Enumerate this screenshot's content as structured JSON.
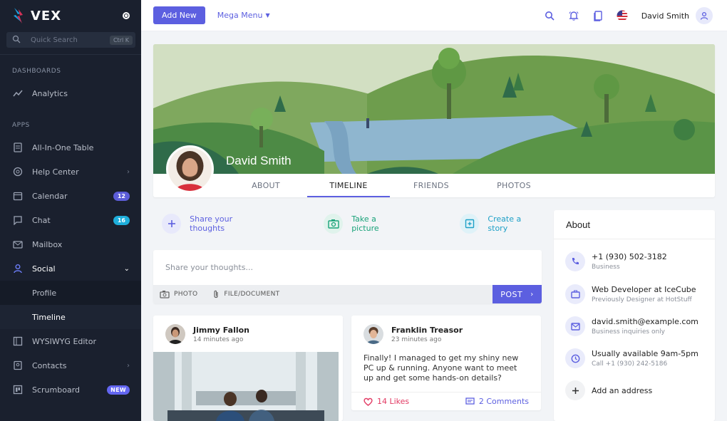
{
  "brand": {
    "name": "VEX"
  },
  "search": {
    "placeholder": "Quick Search",
    "shortcut": "Ctrl K"
  },
  "sidebar": {
    "sections": [
      {
        "label": "DASHBOARDS"
      },
      {
        "label": "APPS"
      }
    ],
    "items": [
      {
        "label": "Analytics",
        "icon": "chart-line-icon"
      },
      {
        "label": "All-In-One Table",
        "icon": "table-icon"
      },
      {
        "label": "Help Center",
        "icon": "help-icon"
      },
      {
        "label": "Calendar",
        "icon": "calendar-icon",
        "badge": "12"
      },
      {
        "label": "Chat",
        "icon": "chat-icon",
        "badge": "16"
      },
      {
        "label": "Mailbox",
        "icon": "mail-icon"
      },
      {
        "label": "Social",
        "icon": "user-icon"
      },
      {
        "label": "WYSIWYG Editor",
        "icon": "editor-icon"
      },
      {
        "label": "Contacts",
        "icon": "contacts-icon"
      },
      {
        "label": "Scrumboard",
        "icon": "board-icon",
        "badge": "NEW"
      }
    ],
    "social_children": [
      {
        "label": "Profile"
      },
      {
        "label": "Timeline"
      }
    ]
  },
  "topbar": {
    "add_new": "Add New",
    "mega_menu": "Mega Menu",
    "user_name": "David Smith"
  },
  "profile": {
    "name": "David Smith",
    "tabs": [
      {
        "label": "ABOUT"
      },
      {
        "label": "TIMELINE"
      },
      {
        "label": "FRIENDS"
      },
      {
        "label": "PHOTOS"
      }
    ]
  },
  "share": {
    "thoughts": "Share your thoughts",
    "picture": "Take a picture",
    "story": "Create a story"
  },
  "composer": {
    "placeholder": "Share your thoughts...",
    "photo": "PHOTO",
    "file": "FILE/DOCUMENT",
    "post": "POST"
  },
  "posts": [
    {
      "author": "Jimmy Fallon",
      "time": "14 minutes ago"
    },
    {
      "author": "Franklin Treasor",
      "time": "23 minutes ago",
      "text": "Finally! I managed to get my shiny new PC up & running. Anyone want to meet up and get some hands-on details?",
      "likes": "14 Likes",
      "comments": "2 Comments"
    }
  ],
  "about": {
    "title": "About",
    "items": [
      {
        "main": "+1 (930) 502-3182",
        "sub": "Business",
        "icon": "phone-icon"
      },
      {
        "main": "Web Developer at IceCube",
        "sub": "Previously Designer at HotStuff",
        "icon": "briefcase-icon"
      },
      {
        "main": "david.smith@example.com",
        "sub": "Business inquiries only",
        "icon": "mail-icon"
      },
      {
        "main": "Usually available 9am-5pm",
        "sub": "Call +1 (930) 242-5186",
        "icon": "clock-icon"
      },
      {
        "main": "Add an address",
        "icon": "add-icon"
      }
    ]
  },
  "colors": {
    "accent": "#5c5fe0",
    "sidebar": "#1a202e",
    "like": "#e23a63"
  }
}
